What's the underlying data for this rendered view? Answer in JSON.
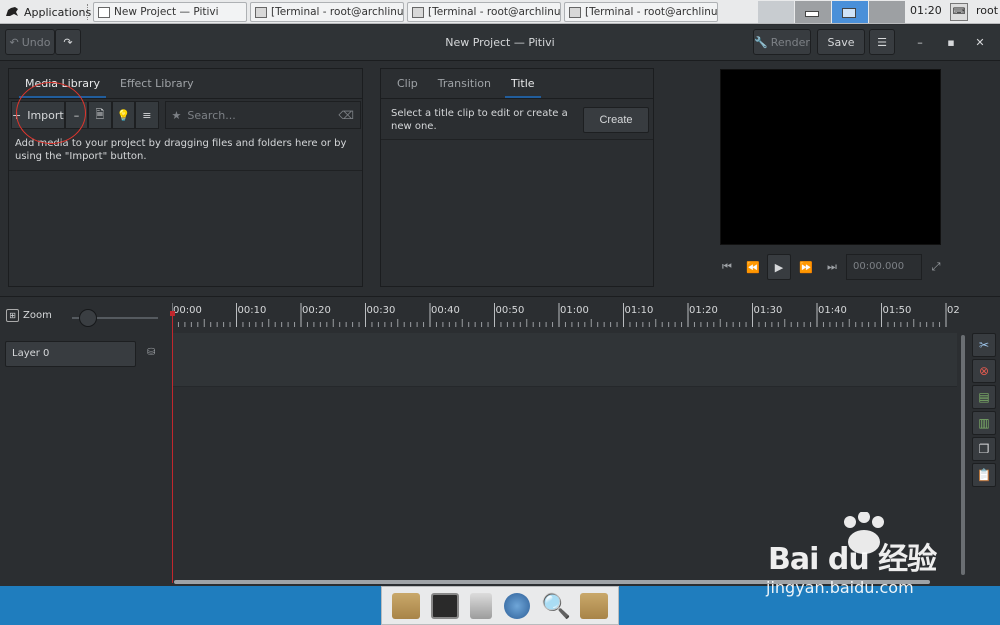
{
  "top_panel": {
    "apps_label": "Applications",
    "tasks": [
      {
        "label": "New Project — Pitivi",
        "icon": "window-icon"
      },
      {
        "label": "[Terminal - root@archlinux:~]",
        "icon": "terminal-icon"
      },
      {
        "label": "[Terminal - root@archlinux:~]",
        "icon": "terminal-icon"
      },
      {
        "label": "[Terminal - root@archlinux:~]",
        "icon": "terminal-icon"
      }
    ],
    "clock": "01:20",
    "user": "root"
  },
  "header": {
    "undo_label": "Undo",
    "title": "New Project — Pitivi",
    "render_label": "Render",
    "save_label": "Save"
  },
  "media_library": {
    "tabs": [
      "Media Library",
      "Effect Library"
    ],
    "import_label": "Import",
    "search_placeholder": "Search...",
    "hint": "Add media to your project by dragging files and folders here or by using the \"Import\" button."
  },
  "clip_panel": {
    "tabs": [
      "Clip",
      "Transition",
      "Title"
    ],
    "hint": "Select a title clip to edit or create a new one.",
    "create_label": "Create"
  },
  "viewer": {
    "timecode_placeholder": "00:00.000"
  },
  "timeline": {
    "zoom_label": "Zoom",
    "layer_label": "Layer 0",
    "ruler_labels": [
      "00:00",
      "00:10",
      "00:20",
      "00:30",
      "00:40",
      "00:50",
      "01:00",
      "01:10",
      "01:20",
      "01:30",
      "01:40",
      "01:50",
      "02"
    ]
  },
  "watermark": {
    "text": "Bai du 经验",
    "url": "jingyan.baidu.com"
  },
  "colors": {
    "accent": "#215d9c",
    "playhead": "#c1272d",
    "annotation": "#e0352d",
    "taskbar": "#1f7dbe"
  }
}
